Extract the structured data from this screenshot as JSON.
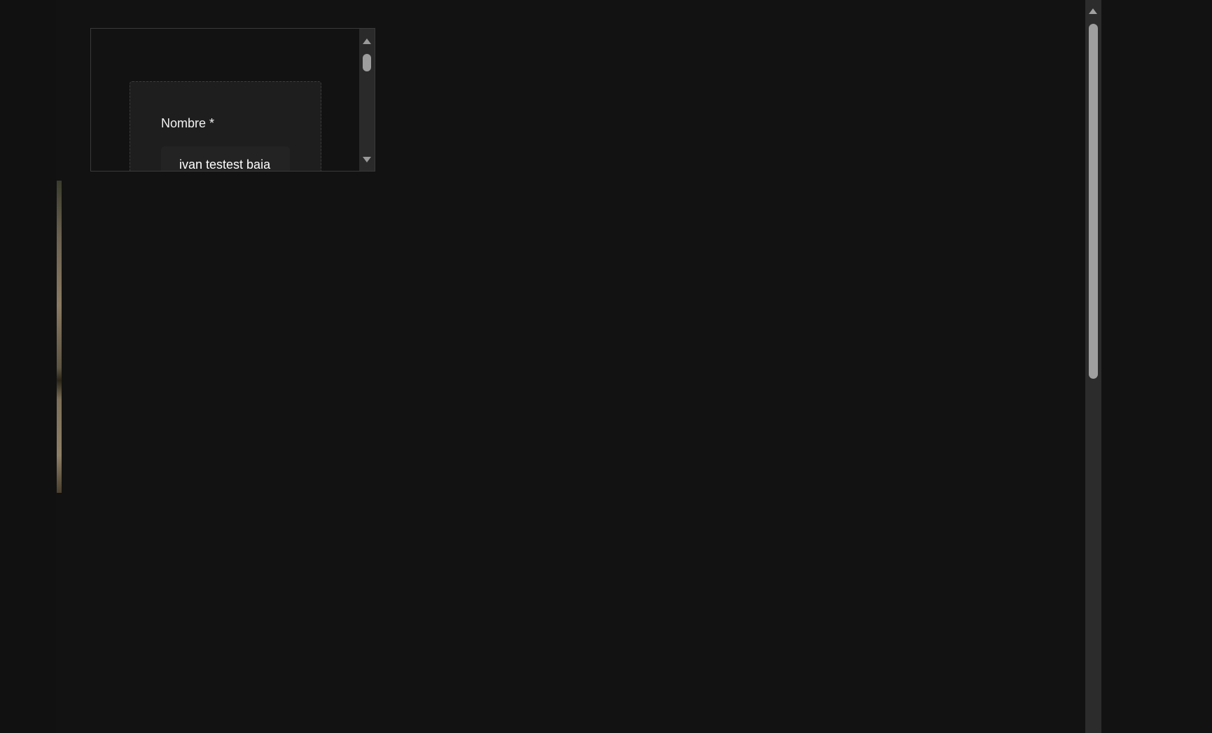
{
  "form": {
    "name_label": "Nombre *",
    "name_value": "ivan testest baia"
  },
  "colors": {
    "background": "#121212",
    "card": "#1e1e1e",
    "scrollbar_track": "#2c2c2c",
    "scrollbar_thumb": "#9f9f9f",
    "text": "#ffffff"
  },
  "icons": {
    "inner_up": "scroll-up-arrow-icon",
    "inner_down": "scroll-down-arrow-icon",
    "main_up": "scroll-up-arrow-icon"
  }
}
